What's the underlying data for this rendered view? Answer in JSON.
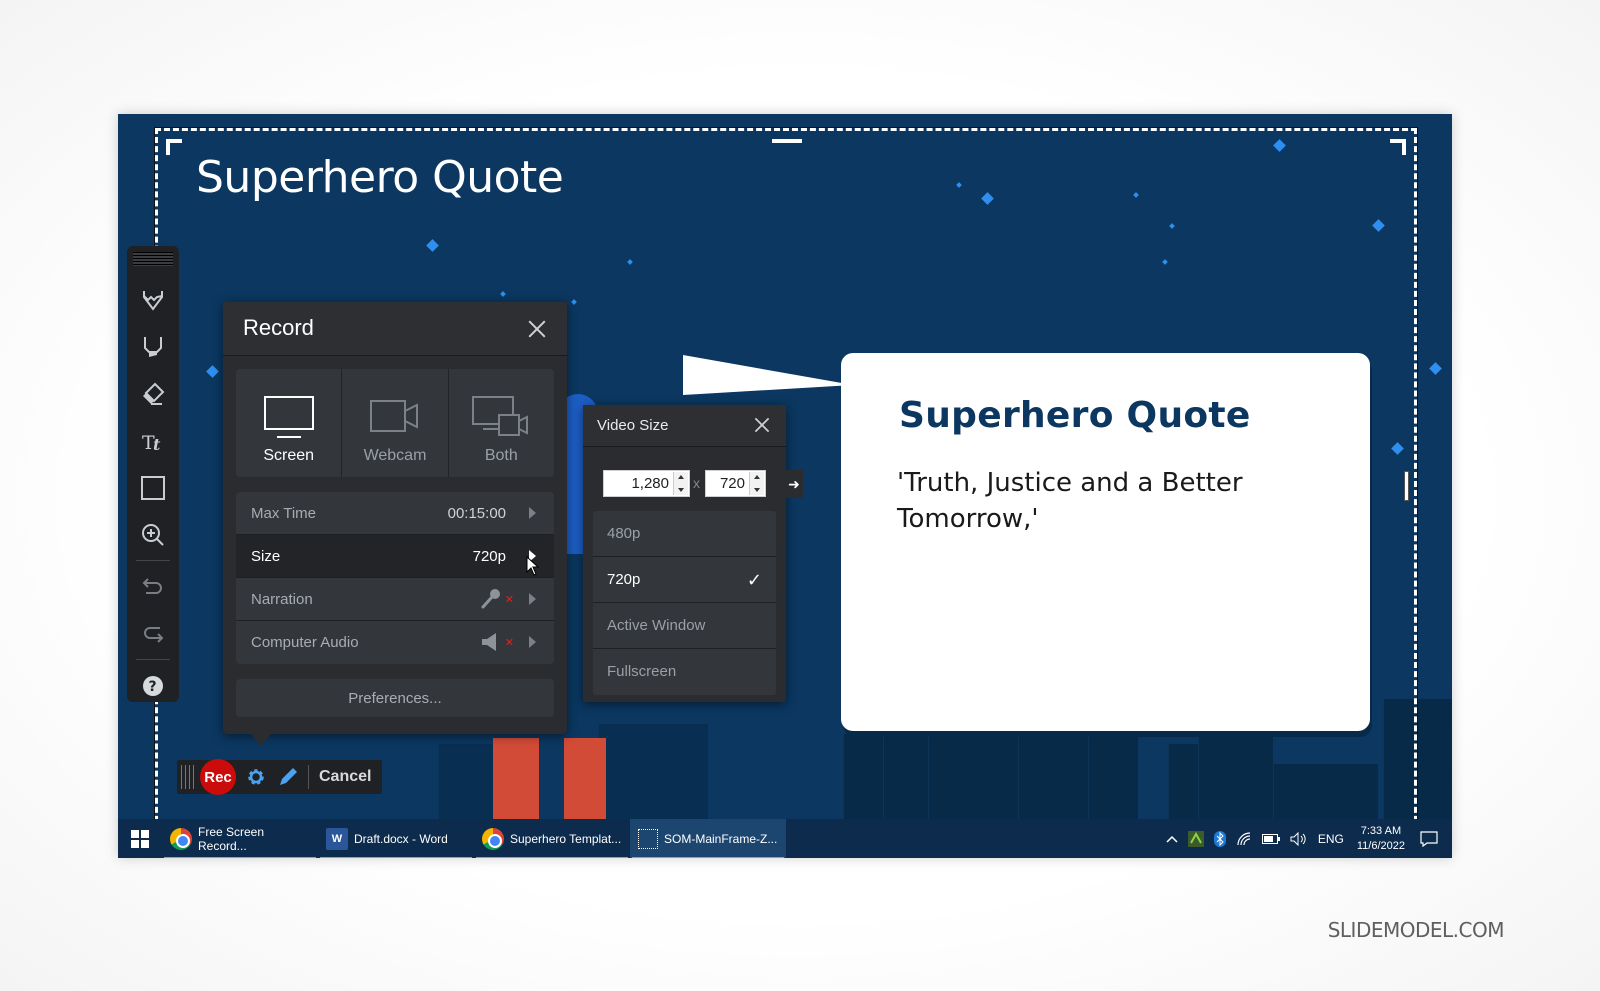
{
  "slide": {
    "title": "Superhero Quote",
    "bubble_title": "Superhero Quote",
    "quote": "'Truth, Justice and a Better Tomorrow,'"
  },
  "draw_toolbar": {
    "tools": [
      {
        "name": "pen",
        "icon": "pen-icon"
      },
      {
        "name": "highlighter",
        "icon": "highlighter-icon"
      },
      {
        "name": "eraser",
        "icon": "eraser-icon"
      },
      {
        "name": "text",
        "icon": "text-icon"
      },
      {
        "name": "rectangle",
        "icon": "rectangle-icon"
      },
      {
        "name": "zoom",
        "icon": "zoom-in-icon"
      },
      {
        "name": "undo",
        "icon": "undo-icon"
      },
      {
        "name": "redo",
        "icon": "redo-icon"
      },
      {
        "name": "help",
        "icon": "help-icon"
      }
    ]
  },
  "record_panel": {
    "title": "Record",
    "sources": [
      {
        "label": "Screen",
        "active": true
      },
      {
        "label": "Webcam",
        "active": false
      },
      {
        "label": "Both",
        "active": false
      }
    ],
    "settings": {
      "max_time": {
        "label": "Max Time",
        "value": "00:15:00"
      },
      "size": {
        "label": "Size",
        "value": "720p"
      },
      "narration": {
        "label": "Narration",
        "state": "muted"
      },
      "computer_audio": {
        "label": "Computer Audio",
        "state": "muted"
      }
    },
    "preferences_label": "Preferences..."
  },
  "video_size_panel": {
    "title": "Video Size",
    "width": "1,280",
    "height": "720",
    "times": "x",
    "options": [
      {
        "label": "480p",
        "selected": false
      },
      {
        "label": "720p",
        "selected": true
      },
      {
        "label": "Active Window",
        "selected": false
      },
      {
        "label": "Fullscreen",
        "selected": false
      }
    ],
    "check": "✓"
  },
  "rec_bar": {
    "rec_label": "Rec",
    "cancel_label": "Cancel"
  },
  "taskbar": {
    "items": [
      {
        "label": "Free Screen Record...",
        "icon": "chrome-icon"
      },
      {
        "label": "Draft.docx - Word",
        "icon": "word-icon"
      },
      {
        "label": "Superhero Templat...",
        "icon": "chrome-icon"
      },
      {
        "label": "SOM-MainFrame-Z...",
        "icon": "screen-capture-icon",
        "active": true
      }
    ],
    "language": "ENG",
    "time": "7:33 AM",
    "date": "11/6/2022"
  },
  "watermark": "SLIDEMODEL.COM",
  "colors": {
    "slide_bg": "#0b3760",
    "rec_red": "#cc0b0b",
    "accent_blue": "#4aa3f0",
    "character_red": "#d24b37"
  }
}
